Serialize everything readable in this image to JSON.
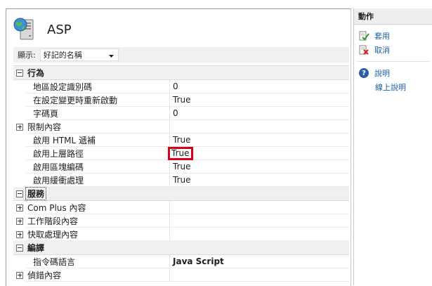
{
  "header": {
    "title": "ASP",
    "icon": "server-globe-icon"
  },
  "display": {
    "label": "顯示:",
    "selected": "好記的名稱"
  },
  "grid": {
    "rows": [
      {
        "kind": "category",
        "label": "行為",
        "expanded": true
      },
      {
        "kind": "prop",
        "name": "地區設定識別碼",
        "value": "0"
      },
      {
        "kind": "prop",
        "name": "在設定變更時重新啟動",
        "value": "True"
      },
      {
        "kind": "prop",
        "name": "字碼頁",
        "value": "0"
      },
      {
        "kind": "prop",
        "name": "限制內容",
        "value": "",
        "expandable": true
      },
      {
        "kind": "prop",
        "name": "啟用 HTML 遞補",
        "value": "True"
      },
      {
        "kind": "prop",
        "name": "啟用上層路徑",
        "value": "True",
        "highlighted": true
      },
      {
        "kind": "prop",
        "name": "啟用區塊編碼",
        "value": "True"
      },
      {
        "kind": "prop",
        "name": "啟用緩衝處理",
        "value": "True"
      },
      {
        "kind": "category",
        "label": "服務",
        "expanded": true,
        "focused": true
      },
      {
        "kind": "prop",
        "name": "Com Plus 內容",
        "value": "",
        "expandable": true
      },
      {
        "kind": "prop",
        "name": "工作階段內容",
        "value": "",
        "expandable": true
      },
      {
        "kind": "prop",
        "name": "快取處理內容",
        "value": "",
        "expandable": true
      },
      {
        "kind": "category",
        "label": "編譯",
        "expanded": true
      },
      {
        "kind": "prop",
        "name": "指令碼語言",
        "value": "Java Script",
        "bold": true
      },
      {
        "kind": "prop",
        "name": "偵錯內容",
        "value": "",
        "expandable": true
      }
    ]
  },
  "actions": {
    "title": "動作",
    "apply": "套用",
    "cancel": "取消",
    "help": "說明",
    "online_help": "線上說明"
  },
  "colors": {
    "highlight": "#d6001c",
    "link": "#1d5fa6",
    "help_icon": "#2c5ea8"
  }
}
